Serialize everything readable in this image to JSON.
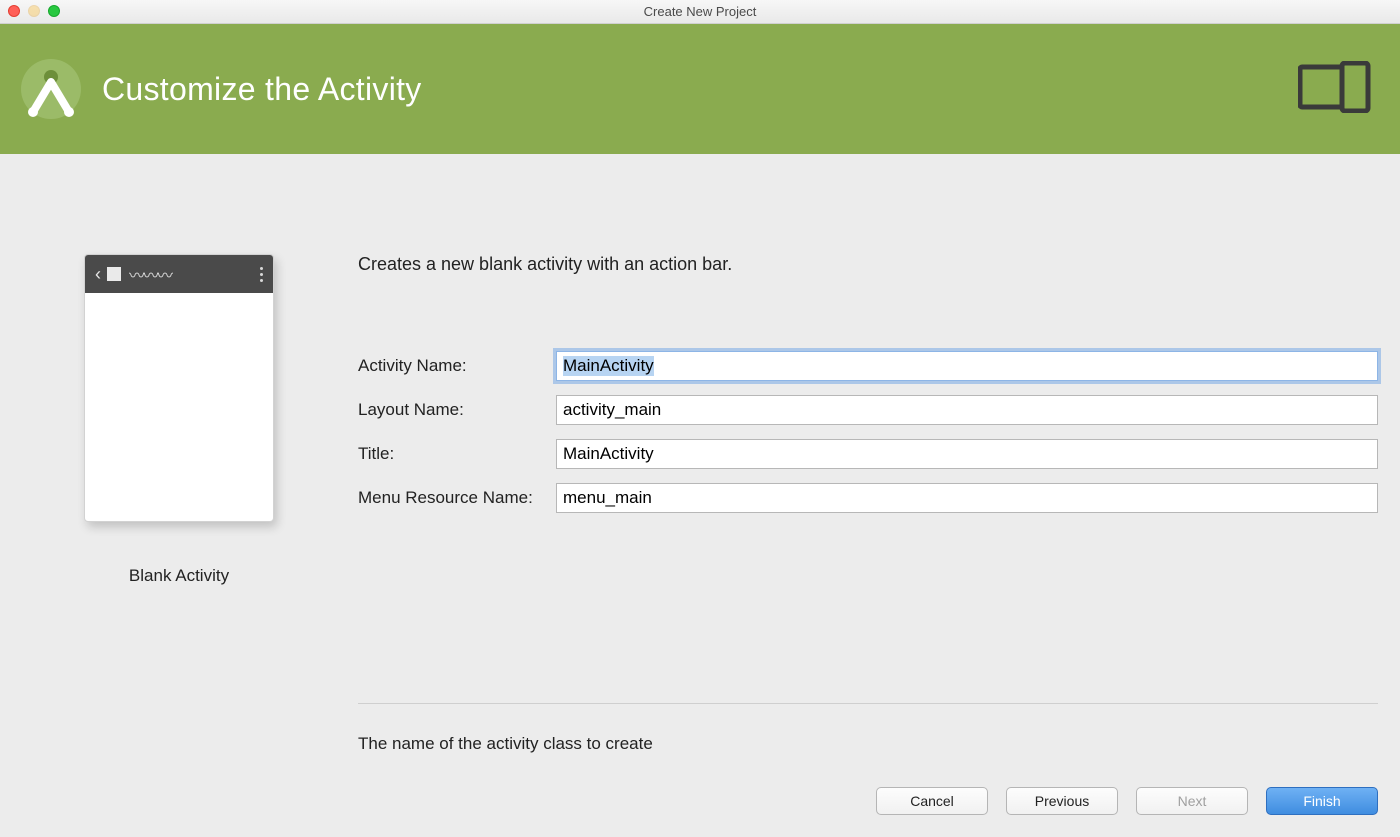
{
  "window": {
    "title": "Create New Project"
  },
  "header": {
    "title": "Customize the Activity"
  },
  "preview": {
    "label": "Blank Activity"
  },
  "form": {
    "description": "Creates a new blank activity with an action bar.",
    "fields": {
      "activity_name": {
        "label": "Activity Name:",
        "value": "MainActivity"
      },
      "layout_name": {
        "label": "Layout Name:",
        "value": "activity_main"
      },
      "title": {
        "label": "Title:",
        "value": "MainActivity"
      },
      "menu_resource": {
        "label": "Menu Resource Name:",
        "value": "menu_main"
      }
    },
    "hint": "The name of the activity class to create"
  },
  "buttons": {
    "cancel": "Cancel",
    "previous": "Previous",
    "next": "Next",
    "finish": "Finish"
  }
}
